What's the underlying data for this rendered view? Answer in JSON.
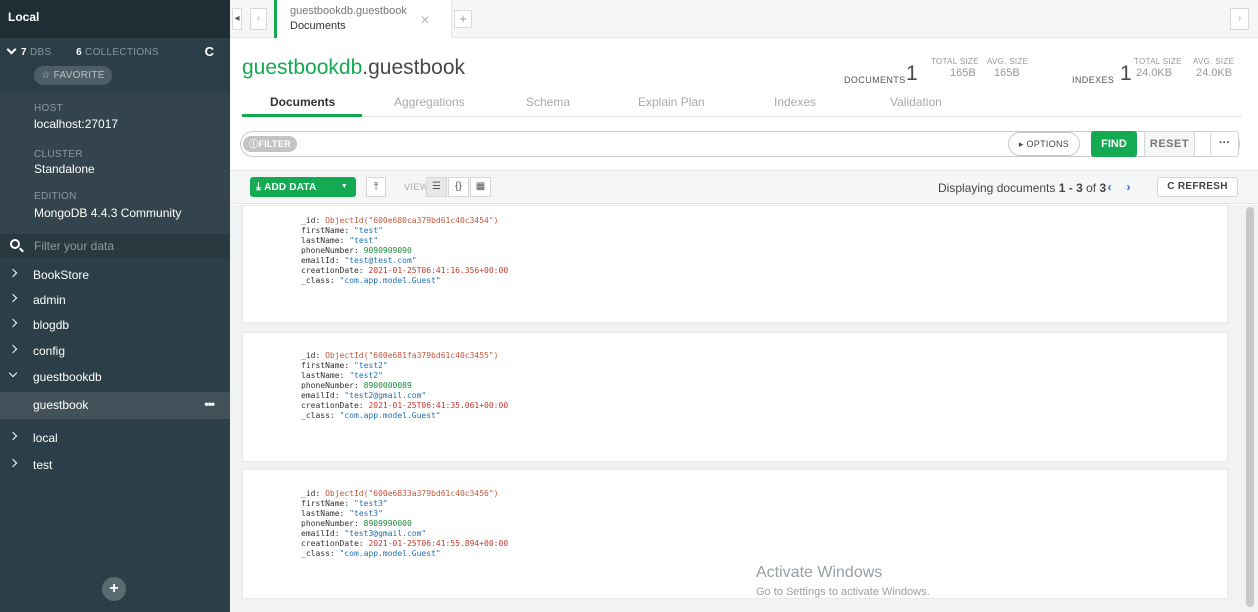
{
  "sidebar": {
    "title": "Local",
    "stats": {
      "dbs_count": "7",
      "dbs_label": "DBS",
      "collections_count": "6",
      "collections_label": "COLLECTIONS"
    },
    "favorite_label": "☆ FAVORITE",
    "host_label": "HOST",
    "host_value": "localhost:27017",
    "cluster_label": "CLUSTER",
    "cluster_value": "Standalone",
    "edition_label": "EDITION",
    "edition_value": "MongoDB 4.4.3 Community",
    "filter_placeholder": "Filter your data",
    "databases": [
      "BookStore",
      "admin",
      "blogdb",
      "config",
      "guestbookdb",
      "local",
      "test"
    ],
    "active_collection": "guestbook"
  },
  "tab": {
    "namespace": "guestbookdb.guestbook",
    "subtitle": "Documents"
  },
  "header": {
    "db_name": "guestbookdb",
    "coll_name": ".guestbook",
    "documents_label": "DOCUMENTS",
    "documents_count": "1",
    "doc_total_size_label": "TOTAL SIZE",
    "doc_total_size": "165B",
    "doc_avg_size_label": "AVG. SIZE",
    "doc_avg_size": "165B",
    "indexes_label": "INDEXES",
    "indexes_count": "1",
    "idx_total_size_label": "TOTAL SIZE",
    "idx_total_size": "24.0KB",
    "idx_avg_size_label": "AVG. SIZE",
    "idx_avg_size": "24.0KB"
  },
  "subtabs": [
    "Documents",
    "Aggregations",
    "Schema",
    "Explain Plan",
    "Indexes",
    "Validation"
  ],
  "query": {
    "filter_label": "FILTER",
    "options_label": "▸ OPTIONS",
    "find_label": "FIND",
    "reset_label": "RESET",
    "more_label": "···"
  },
  "toolbar": {
    "add_data_label": "ADD DATA",
    "view_label": "VIEW",
    "displaying_prefix": "Displaying documents",
    "range": "1 - 3",
    "of_word": "of",
    "total": "3",
    "refresh_label": "REFRESH"
  },
  "documents": [
    {
      "id": "ObjectId(\"600e680ca379bd61c40c3454\")",
      "firstName": "\"test\"",
      "lastName": "\"test\"",
      "phoneNumber": "9090909090",
      "emailId": "\"test@test.com\"",
      "creationDate": "2021-01-25T06:41:16.356+00:00",
      "class": "\"com.app.model.Guest\""
    },
    {
      "id": "ObjectId(\"600e681fa379bd61c40c3455\")",
      "firstName": "\"test2\"",
      "lastName": "\"test2\"",
      "phoneNumber": "8900000089",
      "emailId": "\"test2@gmail.com\"",
      "creationDate": "2021-01-25T06:41:35.061+00:00",
      "class": "\"com.app.model.Guest\""
    },
    {
      "id": "ObjectId(\"600e6833a379bd61c40c3456\")",
      "firstName": "\"test3\"",
      "lastName": "\"test3\"",
      "phoneNumber": "8909990000",
      "emailId": "\"test3@gmail.com\"",
      "creationDate": "2021-01-25T06:41:55.894+00:00",
      "class": "\"com.app.model.Guest\""
    }
  ],
  "watermark": {
    "line1": "Activate Windows",
    "line2": "Go to Settings to activate Windows."
  },
  "colors": {
    "accent": "#13aa52",
    "sidebar": "#2c3f48",
    "link": "#1d6de0"
  }
}
